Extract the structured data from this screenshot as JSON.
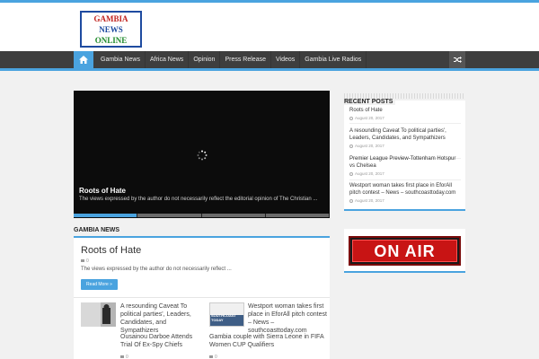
{
  "header": {
    "logo": {
      "line1": "GAMBIA",
      "line2": "NEWS",
      "line3": "ONLINE"
    }
  },
  "nav": {
    "home_icon": "home-icon",
    "items": [
      {
        "label": "Gambia News"
      },
      {
        "label": "Africa News"
      },
      {
        "label": "Opinion"
      },
      {
        "label": "Press Release"
      },
      {
        "label": "Videos"
      },
      {
        "label": "Gambia Live Radios"
      }
    ],
    "random_icon": "shuffle-icon"
  },
  "slider": {
    "title": "Roots of Hate",
    "excerpt": "The views expressed by the author do not necessarily reflect the editorial opinion of The Christian ...",
    "tabs": 4,
    "active_tab": 1
  },
  "gambia_news": {
    "heading": "Gambia News",
    "featured": {
      "title": "Roots of Hate",
      "comments": "0",
      "excerpt": "The views expressed by the author do not necessarily reflect ...",
      "read_more": "Read More »"
    },
    "items": [
      {
        "title": "A resounding Caveat To political parties', Leaders, Candidates, and Sympathizers",
        "comments": "0"
      },
      {
        "title": "Westport woman takes first place in EforAll pitch contest – News – southcoasttoday.com",
        "comments": "0"
      },
      {
        "title": "Ousainou Darboe Attends Trial Of Ex-Spy Chiefs",
        "comments": "0"
      },
      {
        "title": "Gambia couple with Sierra Leone in FIFA Women CUP Qualifiers",
        "comments": "0"
      }
    ],
    "thumb_text": "SOUTHCOAST TODAY"
  },
  "sidebar": {
    "heading": "Recent Posts",
    "posts": [
      {
        "title": "Roots of Hate",
        "date": "August 20, 2017"
      },
      {
        "title": "A resounding Caveat To political parties', Leaders, Candidates, and Sympathizers",
        "date": "August 20, 2017"
      },
      {
        "title": "Premier League Preview-Tottenham Hotspur vs Chelsea",
        "date": "August 20, 2017"
      },
      {
        "title": "Westport woman takes first place in EforAll pitch contest – News – southcoasttoday.com",
        "date": "August 20, 2017"
      }
    ],
    "banner_text": "ON AIR"
  },
  "colors": {
    "accent": "#4aa3df",
    "nav_bg": "#3e3e3e",
    "onair_red": "#c81414"
  }
}
